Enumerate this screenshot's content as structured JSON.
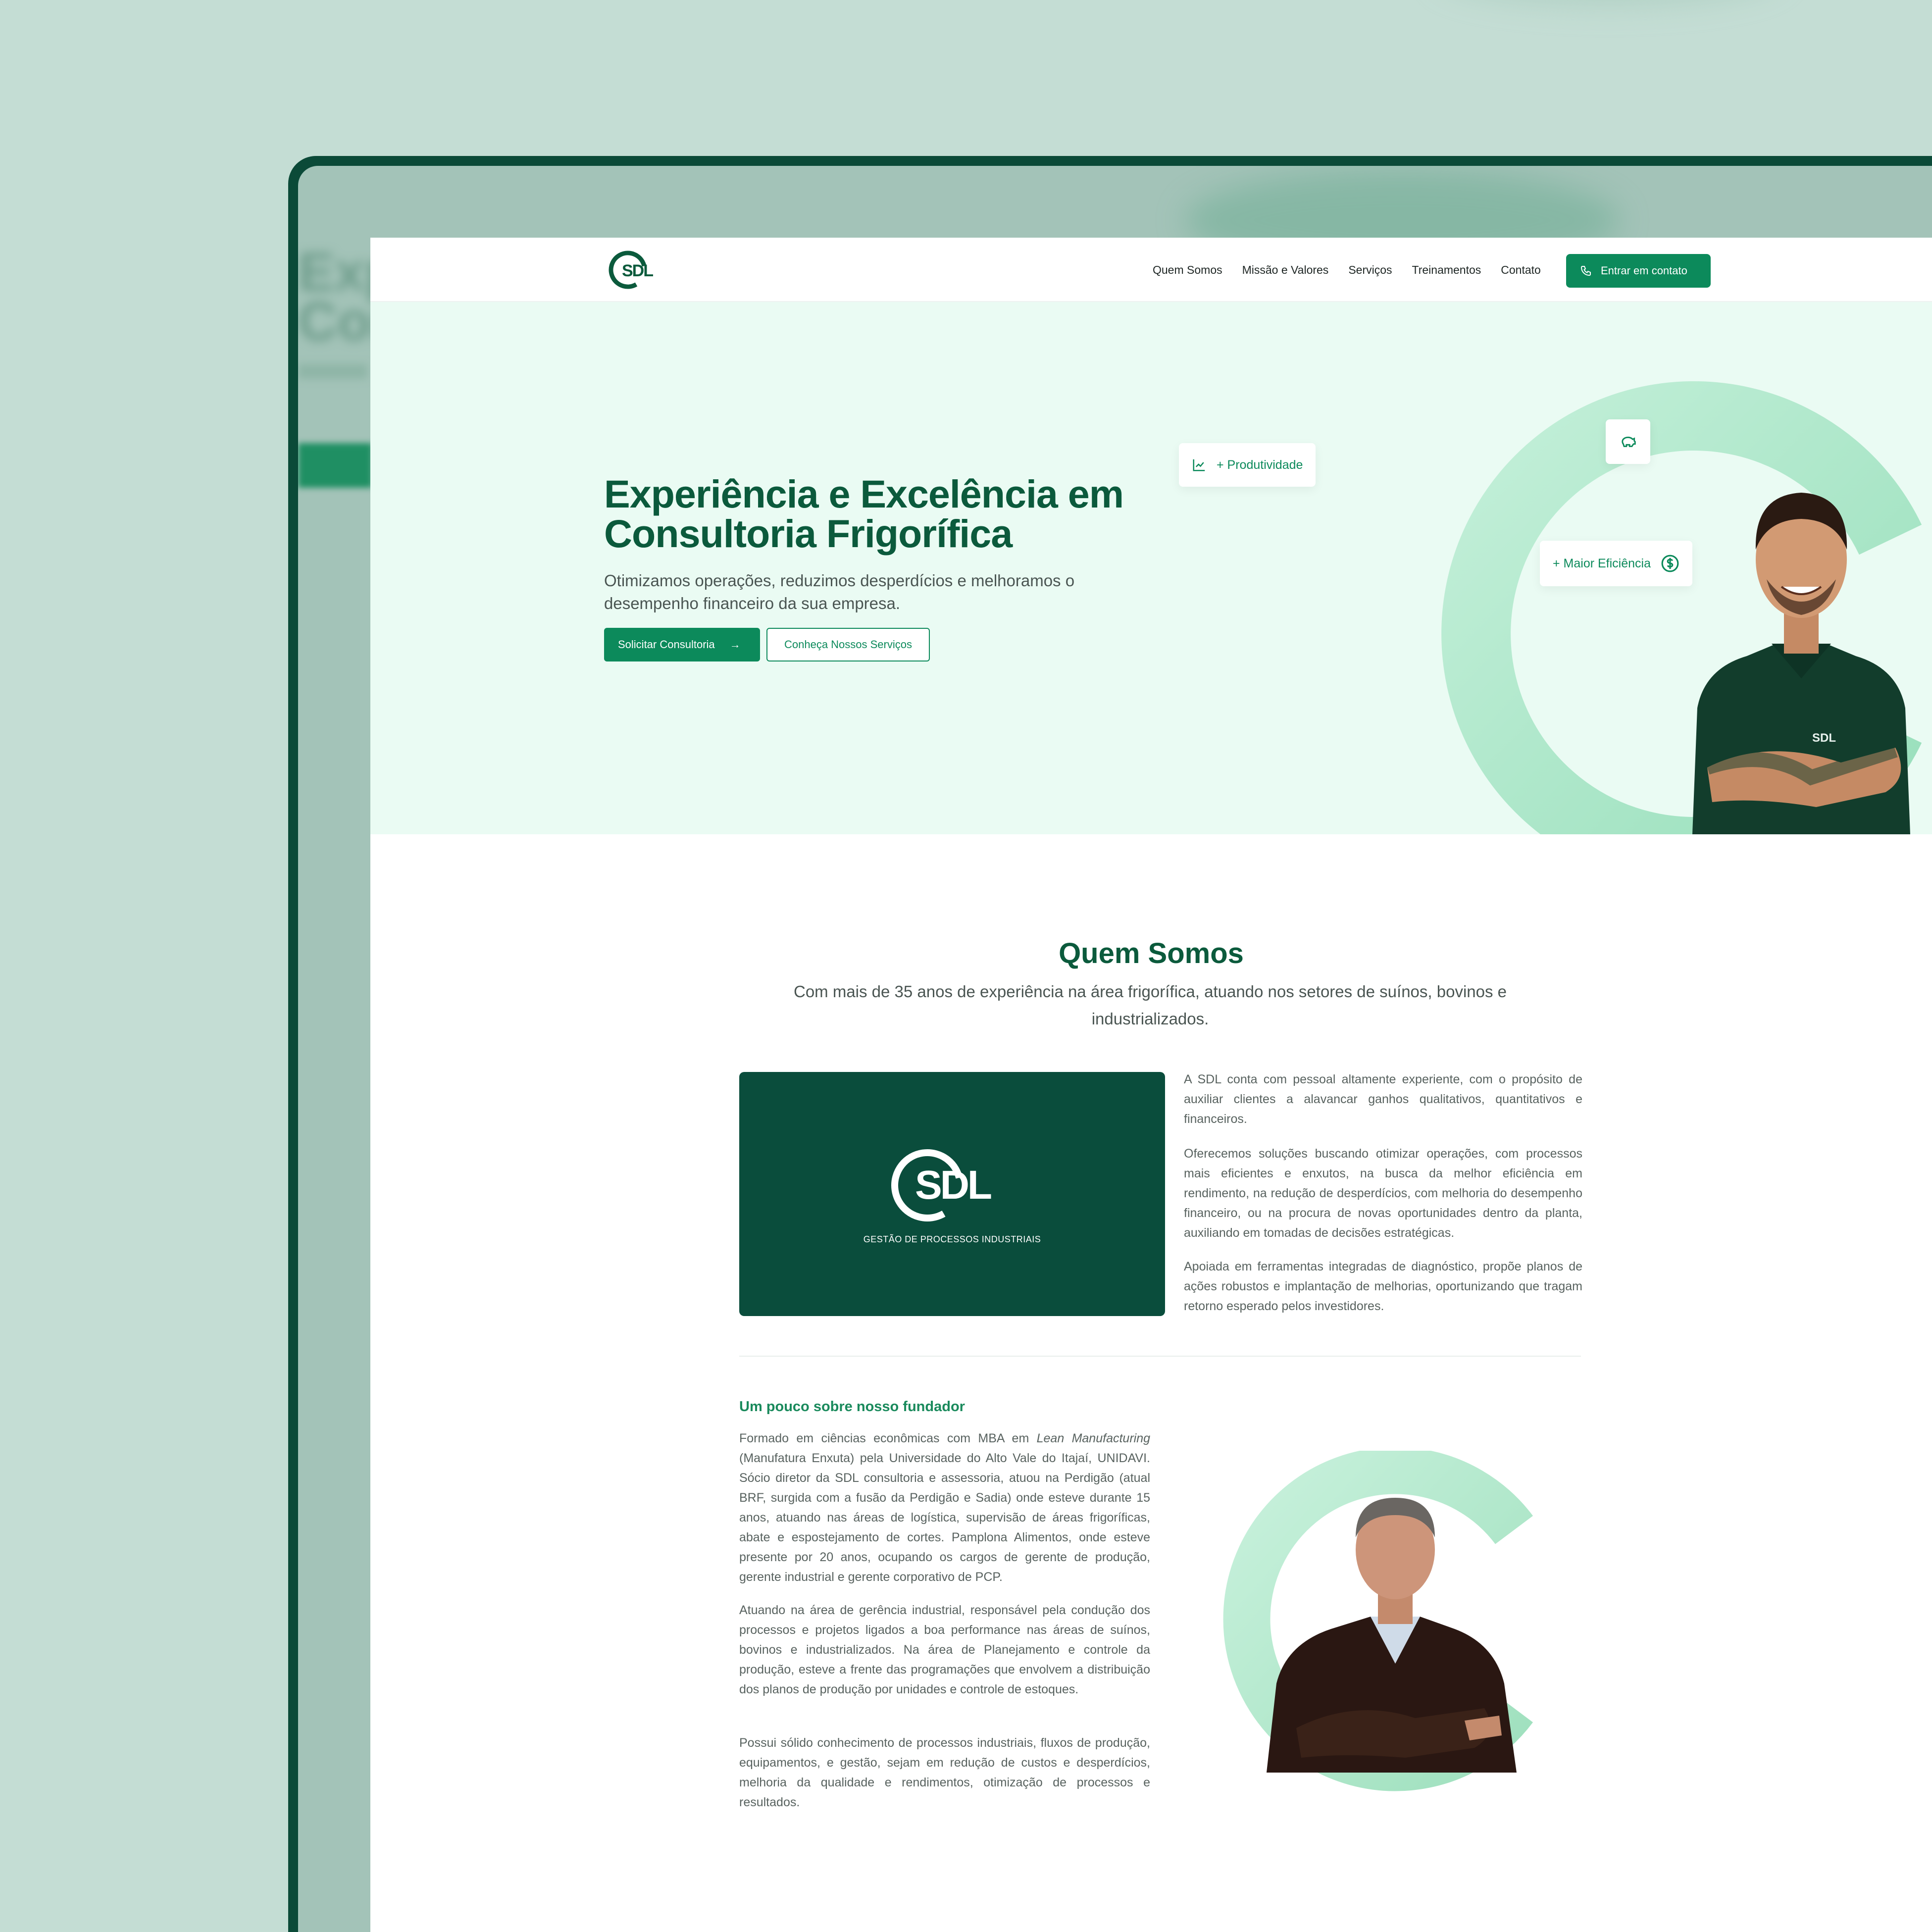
{
  "nav": {
    "logo_text": "SDL",
    "links": [
      "Quem Somos",
      "Missão e Valores",
      "Serviços",
      "Treinamentos",
      "Contato"
    ],
    "cta": "Entrar em contato"
  },
  "hero": {
    "title": "Experiência e Excelência em Consultoria Frigorífica",
    "subtitle": "Otimizamos operações, reduzimos desperdícios e melhoramos o desempenho financeiro da sua empresa.",
    "primary_button": "Solicitar Consultoria",
    "secondary_button": "Conheça Nossos Serviços",
    "badges": {
      "productivity": "+ Produtividade",
      "efficiency": "+ Maior Eficiência"
    },
    "shirt_logo": "SDL"
  },
  "about": {
    "title": "Quem Somos",
    "subtitle": "Com mais de 35 anos de experiência na área frigorífica, atuando nos setores de suínos, bovinos e industrializados.",
    "card_logo": "SDL",
    "card_tagline": "GESTÃO DE PROCESSOS INDUSTRIAIS",
    "paragraphs": [
      "A SDL conta com pessoal altamente experiente, com o propósito de auxiliar clientes a alavancar ganhos qualitativos, quantitativos e financeiros.",
      "Oferecemos soluções buscando otimizar operações, com processos mais eficientes e enxutos, na busca da melhor eficiência em rendimento, na redução de desperdícios, com melhoria do desempenho financeiro, ou na procura de novas oportunidades dentro da planta, auxiliando em tomadas de decisões estratégicas.",
      "Apoiada em ferramentas integradas de diagnóstico, propõe planos de ações robustos e implantação de melhorias, oportunizando que tragam retorno esperado pelos investidores."
    ]
  },
  "founder": {
    "title": "Um pouco sobre nosso fundador",
    "p1_before": "Formado em ciências econômicas com MBA em ",
    "p1_italic": "Lean Manufacturing",
    "p1_after": " (Manufatura Enxuta) pela Universidade do Alto Vale do Itajaí, UNIDAVI. Sócio diretor da SDL consultoria e assessoria, atuou na Perdigão (atual BRF, surgida com a fusão da Perdigão e Sadia) onde esteve durante 15 anos, atuando nas áreas de logística, supervisão de áreas frigoríficas, abate e espostejamento de cortes. Pamplona Alimentos, onde esteve presente por 20 anos, ocupando os cargos de gerente de produção, gerente industrial e gerente corporativo de PCP.",
    "p2": "Atuando na área de gerência industrial, responsável pela condução dos processos e projetos ligados a boa performance nas áreas de suínos, bovinos e industrializados. Na área de Planejamento e controle da produção, esteve a frente das programações que envolvem a distribuição dos planos de produção por unidades e controle de estoques.",
    "p3": "Possui sólido conhecimento de processos industriais, fluxos de produção, equipamentos, e gestão, sejam em redução de custos e desperdícios, melhoria da qualidade e rendimentos, otimização de processos e resultados."
  },
  "colors": {
    "brand_dark": "#0b5a3c",
    "brand": "#0c8a5b",
    "hero_bg": "#eafbf3",
    "card_bg": "#0a4d3c"
  }
}
